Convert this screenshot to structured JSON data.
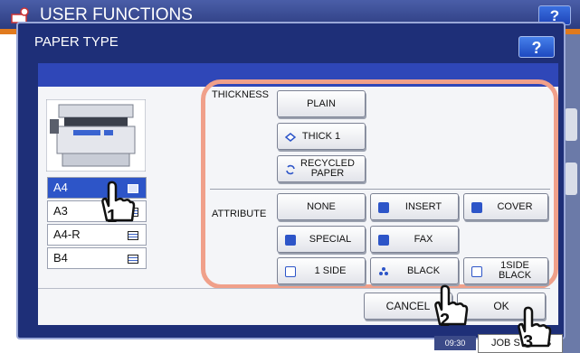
{
  "header": {
    "title": "USER FUNCTIONS",
    "help_label": "?"
  },
  "dialog": {
    "title": "PAPER TYPE",
    "help_label": "?"
  },
  "paper_sizes": [
    {
      "label": "A4",
      "selected": true
    },
    {
      "label": "A3",
      "selected": false
    },
    {
      "label": "A4-R",
      "selected": false
    },
    {
      "label": "B4",
      "selected": false
    }
  ],
  "thickness": {
    "label": "THICKNESS",
    "plain": "PLAIN",
    "thick1": "THICK 1",
    "recycled": "RECYCLED\nPAPER"
  },
  "attribute": {
    "label": "ATTRIBUTE",
    "none": "NONE",
    "insert": "INSERT",
    "cover": "COVER",
    "special": "SPECIAL",
    "fax": "FAX",
    "one_side": "1 SIDE",
    "black": "BLACK",
    "one_side_black": "1SIDE\nBLACK"
  },
  "actions": {
    "cancel": "CANCEL",
    "ok": "OK"
  },
  "footer": {
    "time": "09:30",
    "job_status": "JOB STATUS"
  },
  "callouts": [
    "1",
    "2",
    "3"
  ],
  "colors": {
    "accent_orange": "#e07a1e",
    "highlight_box": "#f0a08a",
    "dialog_blue": "#1e2f78",
    "selected_blue": "#2d55c8"
  }
}
